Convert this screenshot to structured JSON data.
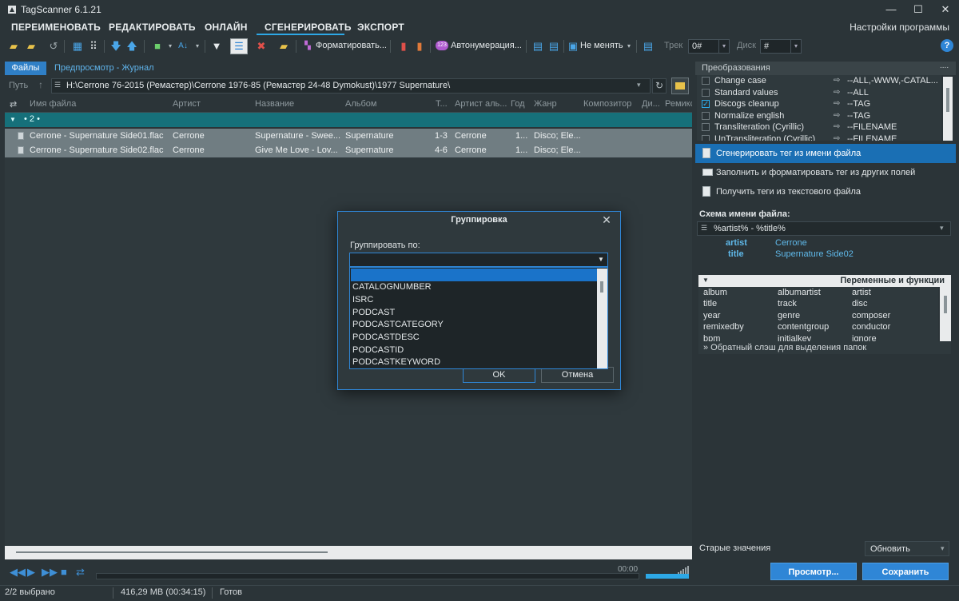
{
  "app": {
    "title": "TagScanner 6.1.21"
  },
  "menu": {
    "items": [
      "ПЕРЕИМЕНОВАТЬ",
      "РЕДАКТИРОВАТЬ",
      "ОНЛАЙН",
      "СГЕНЕРИРОВАТЬ",
      "ЭКСПОРТ"
    ],
    "active": "СГЕНЕРИРОВАТЬ",
    "settings": "Настройки программы"
  },
  "toolbar": {
    "format_label": "Форматировать...",
    "autonumber_icon_text": "123",
    "autonumber_label": "Автонумерация...",
    "nochange_label": "Не менять",
    "track_label": "Трек",
    "track_value": "0#",
    "disc_label": "Диск",
    "disc_value": "#",
    "help": "?"
  },
  "left_panel": {
    "tabs": {
      "files": "Файлы",
      "preview": "Предпросмотр - Журнал"
    },
    "path_label": "Путь",
    "path_value": "H:\\Cerrone 76-2015 (Ремастер)\\Cerrone 1976-85 (Ремастер 24-48 Dymokust)\\1977 Supernature\\",
    "columns": [
      "Имя файла",
      "Артист",
      "Название",
      "Альбом",
      "Т...",
      "Артист аль...",
      "Год",
      "Жанр",
      "Композитор",
      "Ди...",
      "Ремикс"
    ],
    "group_label": "• 2 •",
    "rows": [
      {
        "filename": "Cerrone - Supernature Side01.flac",
        "artist": "Cerrone",
        "title": "Supernature - Swee...",
        "album": "Supernature",
        "track": "1-3",
        "album_artist": "Cerrone",
        "year": "1...",
        "genre": "Disco; Ele..."
      },
      {
        "filename": "Cerrone - Supernature Side02.flac",
        "artist": "Cerrone",
        "title": "Give Me Love - Lov...",
        "album": "Supernature",
        "track": "4-6",
        "album_artist": "Cerrone",
        "year": "1...",
        "genre": "Disco; Ele..."
      }
    ]
  },
  "player": {
    "time": "00:00"
  },
  "status": {
    "selected": "2/2 выбрано",
    "size": "416,29 MB (00:34:15)",
    "state": "Готов"
  },
  "right_panel": {
    "header": "Преобразования",
    "header_dots": "....",
    "transforms": [
      {
        "name": "Change case",
        "checked": false,
        "value": "--ALL,-WWW,-CATAL..."
      },
      {
        "name": "Standard values",
        "checked": false,
        "value": "--ALL"
      },
      {
        "name": "Discogs cleanup",
        "checked": true,
        "value": "--TAG"
      },
      {
        "name": "Normalize english",
        "checked": false,
        "value": "--TAG"
      },
      {
        "name": "Transliteration (Cyrillic)",
        "checked": false,
        "value": "--FILENAME"
      },
      {
        "name": "UnTransliteration (Cyrillic)",
        "checked": false,
        "value": "--FILENAME"
      }
    ],
    "actions": [
      {
        "label": "Сгенерировать тег из имени файла",
        "selected": true
      },
      {
        "label": "Заполнить и форматировать тег из других полей",
        "selected": false
      },
      {
        "label": "Получить теги из текстового файла",
        "selected": false
      }
    ],
    "scheme_label": "Схема имени файла:",
    "scheme_value": "%artist% - %title%",
    "preview": [
      {
        "key": "artist",
        "value": "Cerrone"
      },
      {
        "key": "title",
        "value": "Supernature Side02"
      }
    ],
    "vars_header": "Переменные и функции",
    "vars": [
      "album",
      "albumartist",
      "artist",
      "title",
      "track",
      "disc",
      "year",
      "genre",
      "composer",
      "remixedby",
      "contentgroup",
      "conductor",
      "bpm",
      "initialkey",
      "ignore"
    ],
    "vars_hint": "» Обратный слэш для выделения папок",
    "old_values_label": "Старые значения",
    "old_values_select": "Обновить",
    "preview_button": "Просмотр...",
    "save_button": "Сохранить"
  },
  "dialog": {
    "title": "Группировка",
    "label": "Группировать по:",
    "selected_value": "",
    "options": [
      "",
      "CATALOGNUMBER",
      "ISRC",
      "PODCAST",
      "PODCASTCATEGORY",
      "PODCASTDESC",
      "PODCASTID",
      "PODCASTKEYWORD"
    ],
    "ok": "OK",
    "cancel": "Отмена"
  },
  "colors": {
    "accent": "#2f86d6",
    "group": "#16707a",
    "row": "#707d82",
    "bg": "#2b3438"
  }
}
